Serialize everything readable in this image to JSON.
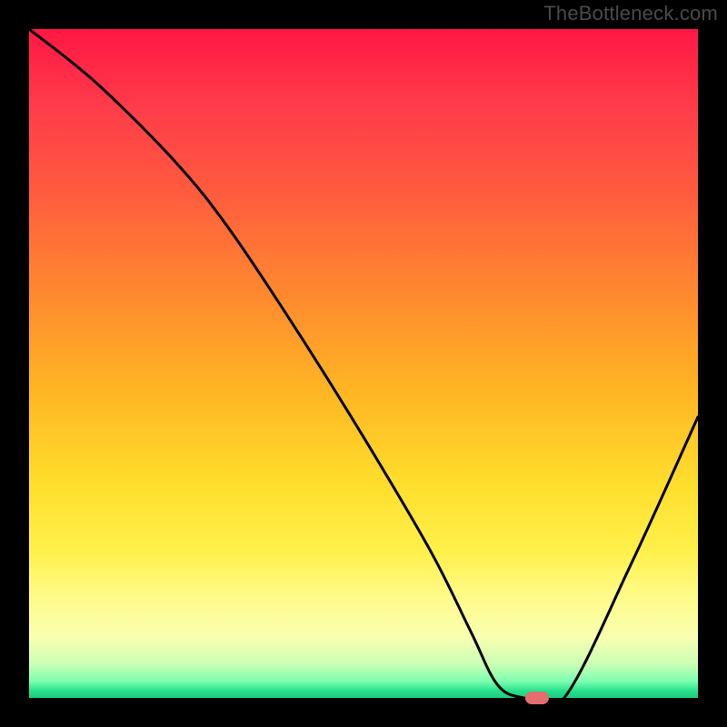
{
  "watermark": "TheBottleneck.com",
  "colors": {
    "background": "#000000",
    "curve": "#000000",
    "marker": "#e36d6f"
  },
  "chart_data": {
    "type": "line",
    "title": "",
    "xlabel": "",
    "ylabel": "",
    "xlim": [
      0,
      100
    ],
    "ylim": [
      0,
      100
    ],
    "grid": false,
    "series": [
      {
        "name": "bottleneck-curve",
        "x": [
          0,
          10,
          22,
          30,
          40,
          50,
          60,
          66,
          70,
          74,
          80,
          90,
          100
        ],
        "y": [
          100,
          92,
          80,
          70,
          55,
          39,
          22,
          10,
          2,
          0,
          0,
          20,
          42
        ]
      }
    ],
    "marker": {
      "x": 76,
      "y": 0
    },
    "annotations": []
  }
}
